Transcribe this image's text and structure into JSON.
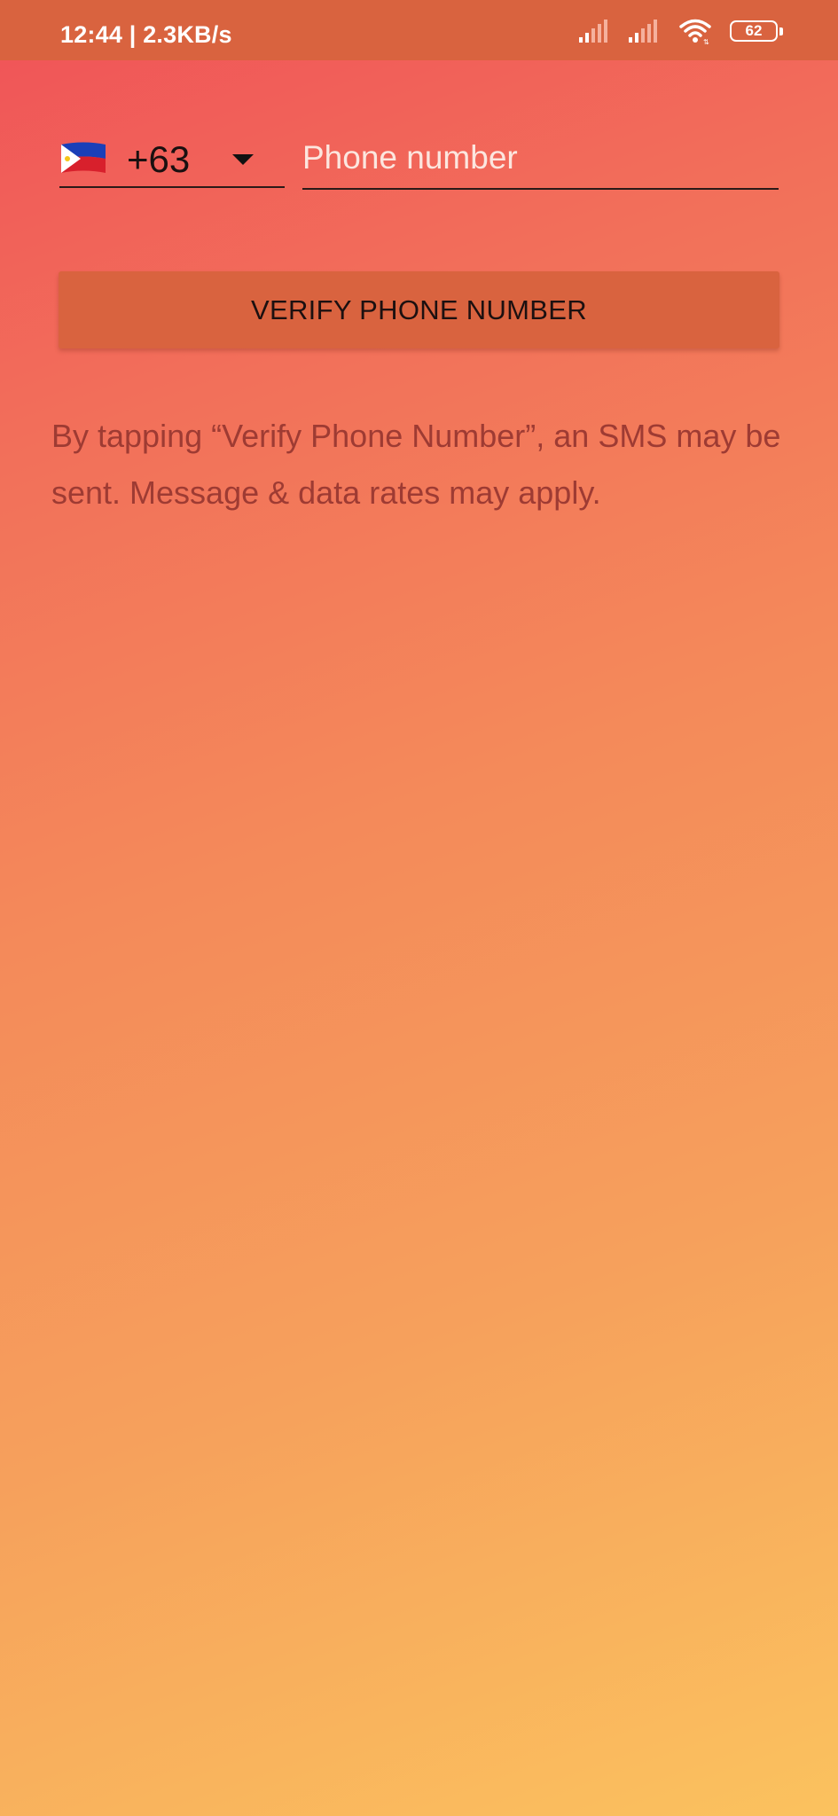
{
  "status_bar": {
    "time_speed": "12:44 | 2.3KB/s",
    "battery_level": "62",
    "icons": [
      "signal-icon",
      "signal-icon",
      "wifi-icon",
      "battery-icon"
    ]
  },
  "phone_form": {
    "country_flag": "flag-philippines-icon",
    "dial_code": "+63",
    "phone_placeholder": "Phone number",
    "phone_value": ""
  },
  "verify_button_label": "VERIFY PHONE NUMBER",
  "disclaimer": "By tapping “Verify Phone Number”, an SMS may be sent. Message & data rates may apply.",
  "colors": {
    "status_bar": "#d9633f",
    "button": "#d9633f",
    "gradient_top": "#f05258",
    "gradient_bottom": "#fbc25e",
    "disclaimer_text": "#9e3b33"
  }
}
